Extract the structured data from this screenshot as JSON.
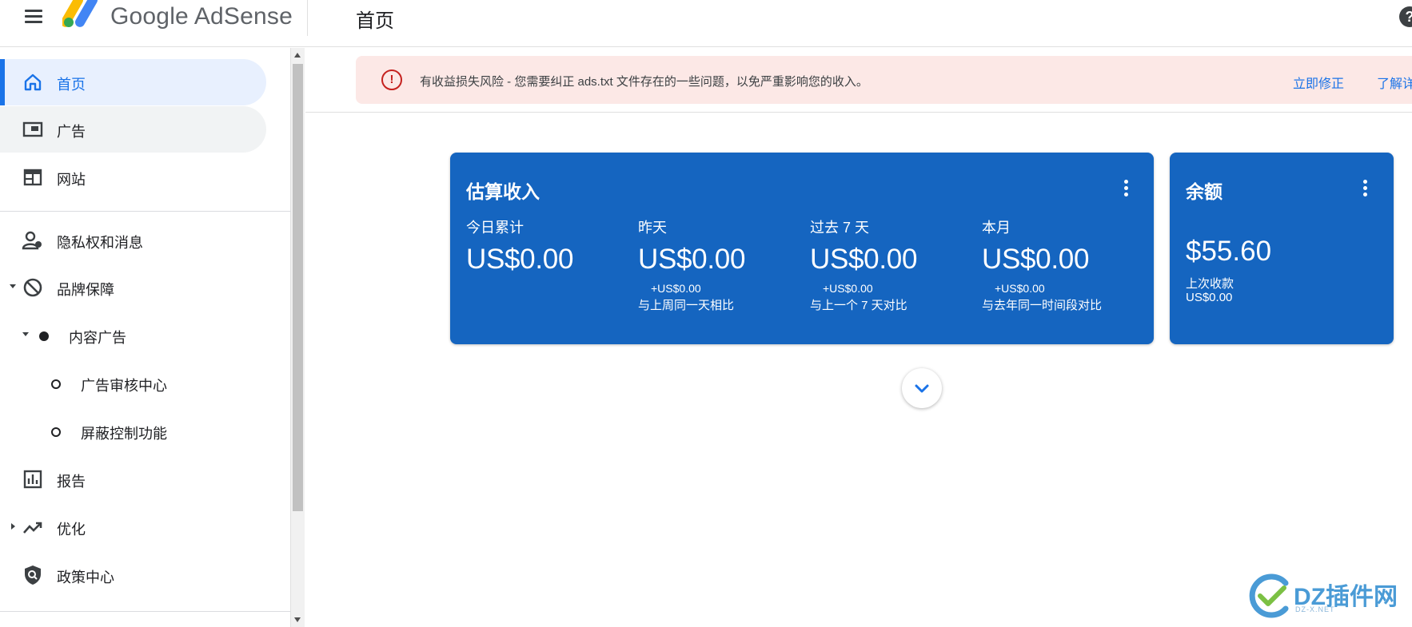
{
  "app": {
    "product_name": "Google AdSense",
    "page_title": "首页"
  },
  "sidebar": {
    "items": [
      {
        "label": "首页",
        "icon": "home-icon",
        "state": "active"
      },
      {
        "label": "广告",
        "icon": "ads-icon",
        "state": "hover"
      },
      {
        "label": "网站",
        "icon": "sites-icon"
      },
      {
        "label": "隐私权和消息",
        "icon": "privacy-icon"
      },
      {
        "label": "品牌保障",
        "icon": "block-icon",
        "expanded": true
      },
      {
        "label": "内容广告",
        "icon": "dot-icon",
        "expanded": true
      },
      {
        "label": "广告审核中心",
        "icon": "hollow-dot-icon"
      },
      {
        "label": "屏蔽控制功能",
        "icon": "hollow-dot-icon"
      },
      {
        "label": "报告",
        "icon": "bar-chart-icon"
      },
      {
        "label": "优化",
        "icon": "trending-up-icon",
        "expanded": false
      },
      {
        "label": "政策中心",
        "icon": "shield-search-icon"
      }
    ]
  },
  "alert": {
    "message": "有收益损失风险 - 您需要纠正 ads.txt 文件存在的一些问题，以免严重影响您的收入。",
    "fix_label": "立即修正",
    "learn_label": "了解详情",
    "color": "#fce8e6"
  },
  "earnings_card": {
    "title": "估算收入",
    "metrics": [
      {
        "label": "今日累计",
        "value": "US$0.00",
        "change": "",
        "compare": ""
      },
      {
        "label": "昨天",
        "value": "US$0.00",
        "change": "+US$0.00",
        "compare": "与上周同一天相比"
      },
      {
        "label": "过去 7 天",
        "value": "US$0.00",
        "change": "+US$0.00",
        "compare": "与上一个 7 天对比"
      },
      {
        "label": "本月",
        "value": "US$0.00",
        "change": "+US$0.00",
        "compare": "与去年同一时间段对比"
      }
    ]
  },
  "balance_card": {
    "title": "余额",
    "value": "$55.60",
    "last_payment_label": "上次收款",
    "last_payment_value": "US$0.00"
  },
  "watermark": {
    "text": "DZ插件网",
    "sub": "DZ-X.NET"
  },
  "colors": {
    "card_blue": "#1565c0",
    "accent": "#1a73e8",
    "alert_red": "#c5221f"
  }
}
